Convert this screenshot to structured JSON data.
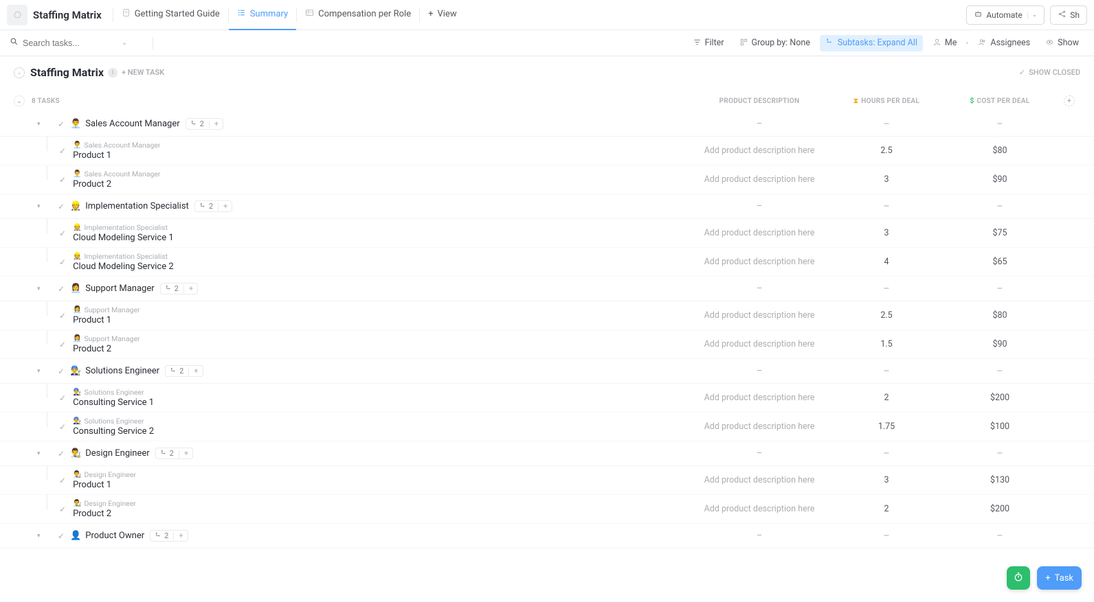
{
  "app_title": "Staffing Matrix",
  "tabs": [
    {
      "label": "Getting Started Guide",
      "icon": "doc"
    },
    {
      "label": "Summary",
      "icon": "list",
      "active": true
    },
    {
      "label": "Compensation per Role",
      "icon": "table"
    }
  ],
  "add_view": "View",
  "actions": {
    "automate": "Automate",
    "share": "Sh"
  },
  "search": {
    "placeholder": "Search tasks..."
  },
  "filters": {
    "filter": "Filter",
    "groupby": "Group by: None",
    "subtasks": "Subtasks: Expand All",
    "me": "Me",
    "assignees": "Assignees",
    "show": "Show"
  },
  "list": {
    "title": "Staffing Matrix",
    "new_task": "+ NEW TASK",
    "show_closed": "SHOW CLOSED",
    "task_count": "8 TASKS",
    "columns": {
      "desc": "PRODUCT DESCRIPTION",
      "hours": "HOURS PER DEAL",
      "cost": "COST PER DEAL"
    }
  },
  "tasks": [
    {
      "emoji": "👨‍💼",
      "name": "Sales Account Manager",
      "sub_count": "2",
      "subs": [
        {
          "breadcrumb": "Sales Account Manager",
          "name": "Product 1",
          "desc": "Add product description here",
          "hours": "2.5",
          "cost": "$80"
        },
        {
          "breadcrumb": "Sales Account Manager",
          "name": "Product 2",
          "desc": "Add product description here",
          "hours": "3",
          "cost": "$90"
        }
      ]
    },
    {
      "emoji": "👷",
      "name": "Implementation Specialist",
      "sub_count": "2",
      "subs": [
        {
          "breadcrumb": "Implementation Specialist",
          "name": "Cloud Modeling Service 1",
          "desc": "Add product description here",
          "hours": "3",
          "cost": "$75"
        },
        {
          "breadcrumb": "Implementation Specialist",
          "name": "Cloud Modeling Service 2",
          "desc": "Add product description here",
          "hours": "4",
          "cost": "$65"
        }
      ]
    },
    {
      "emoji": "👩‍💼",
      "name": "Support Manager",
      "sub_count": "2",
      "subs": [
        {
          "breadcrumb": "Support Manager",
          "name": "Product 1",
          "desc": "Add product description here",
          "hours": "2.5",
          "cost": "$80"
        },
        {
          "breadcrumb": "Support Manager",
          "name": "Product 2",
          "desc": "Add product description here",
          "hours": "1.5",
          "cost": "$90"
        }
      ]
    },
    {
      "emoji": "👨‍🔧",
      "name": "Solutions Engineer",
      "sub_count": "2",
      "subs": [
        {
          "breadcrumb": "Solutions Engineer",
          "name": "Consulting Service 1",
          "desc": "Add product description here",
          "hours": "2",
          "cost": "$200"
        },
        {
          "breadcrumb": "Solutions Engineer",
          "name": "Consulting Service 2",
          "desc": "Add product description here",
          "hours": "1.75",
          "cost": "$100"
        }
      ]
    },
    {
      "emoji": "👨‍🎨",
      "name": "Design Engineer",
      "sub_count": "2",
      "subs": [
        {
          "breadcrumb": "Design Engineer",
          "name": "Product 1",
          "desc": "Add product description here",
          "hours": "3",
          "cost": "$130"
        },
        {
          "breadcrumb": "Design Engineer",
          "name": "Product 2",
          "desc": "Add product description here",
          "hours": "2",
          "cost": "$200"
        }
      ]
    },
    {
      "emoji": "👤",
      "name": "Product Owner",
      "sub_count": "2",
      "subs": []
    }
  ],
  "fab": {
    "task": "Task"
  }
}
